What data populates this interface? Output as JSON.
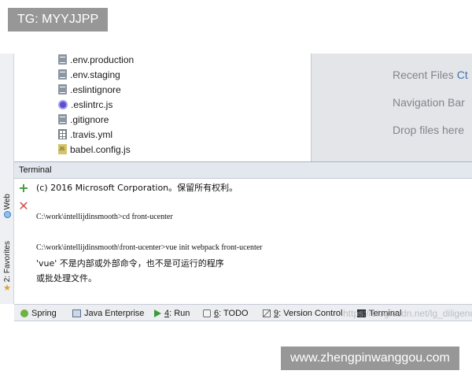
{
  "watermarks": {
    "top_left": "TG: MYYJJPP",
    "bottom_right": "www.zhengpinwanggou.com",
    "overlay": "https://blog.csdn.net/lg_diligence"
  },
  "left_strip": {
    "web_label": "Web",
    "favorites_label": "2: Favorites"
  },
  "project_tree": {
    "items": [
      {
        "name": ".env.production",
        "icon": "file-doc-icon"
      },
      {
        "name": ".env.staging",
        "icon": "file-doc-icon"
      },
      {
        "name": ".eslintignore",
        "icon": "file-doc-icon"
      },
      {
        "name": ".eslintrc.js",
        "icon": "eslint-icon"
      },
      {
        "name": ".gitignore",
        "icon": "file-doc-icon"
      },
      {
        "name": ".travis.yml",
        "icon": "yml-grid-icon"
      },
      {
        "name": "babel.config.js",
        "icon": "js-file-icon"
      }
    ]
  },
  "editor_hints": {
    "recent_files": "Recent Files",
    "recent_files_shortcut": "Ct",
    "navigation_bar": "Navigation Bar",
    "drop_files": "Drop files here"
  },
  "terminal": {
    "title": "Terminal",
    "lines": [
      "(c) 2016 Microsoft Corporation。保留所有权利。",
      "C:\\work\\intellijdinsmooth>cd front-ucenter",
      "C:\\work\\intellijdinsmooth\\front-ucenter>vue init webpack front-ucenter",
      "'vue' 不是内部或外部命令，也不是可运行的程序",
      "或批处理文件。"
    ]
  },
  "status_bar": {
    "spring": "Spring",
    "java_enterprise": "Java Enterprise",
    "run_key": "4",
    "run_label": ": Run",
    "todo_key": "6",
    "todo_label": ": TODO",
    "vcs_key": "9",
    "vcs_label": ": Version Control",
    "terminal": "Terminal"
  }
}
